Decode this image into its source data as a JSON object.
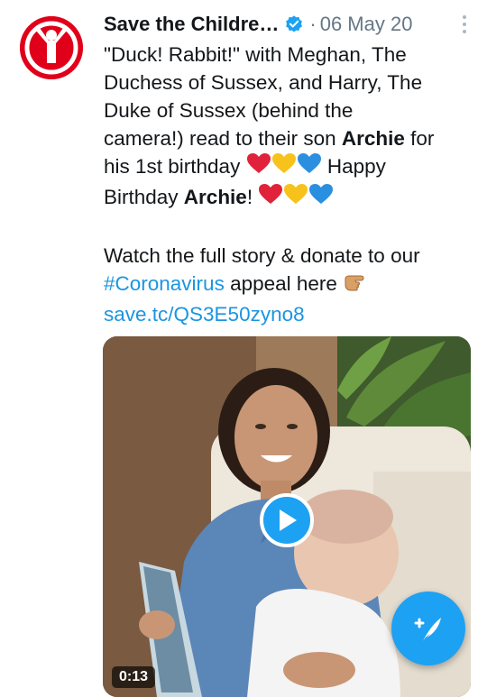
{
  "tweet": {
    "author_name": "Save the Childre…",
    "separator": "·",
    "date": "06 May 20",
    "text": {
      "l1": "\"Duck! Rabbit!\" with Meghan, The",
      "l2": "Duchess of Sussex, and Harry, The",
      "l3": "Duke of Sussex (behind the",
      "l4a": "camera!) read to their son ",
      "l4b": "Archie",
      "l4c": " for",
      "l5a": "his 1st birthday ",
      "l5b": " Happy",
      "l6a": "Birthday ",
      "l6b": "Archie",
      "l6c": "! ",
      "l7": "Watch the full story & donate to our",
      "l8_hashtag": "#Coronavirus",
      "l8_rest": " appeal here ",
      "l9_link": "save.tc/QS3E50zyno8"
    },
    "media": {
      "duration": "0:13"
    }
  },
  "colors": {
    "brand_red": "#e1001a",
    "twitter_blue": "#1da1f2",
    "link_blue": "#1b95e0",
    "secondary_text": "#657786"
  },
  "icons": {
    "avatar": "save-the-children-logo",
    "verified": "verified-badge-icon",
    "more": "more-vertical-icon",
    "play": "play-icon",
    "compose": "compose-tweet-icon",
    "hearts": [
      "red-heart",
      "yellow-heart",
      "blue-heart"
    ],
    "pointing": "backhand-index-pointing-right"
  }
}
